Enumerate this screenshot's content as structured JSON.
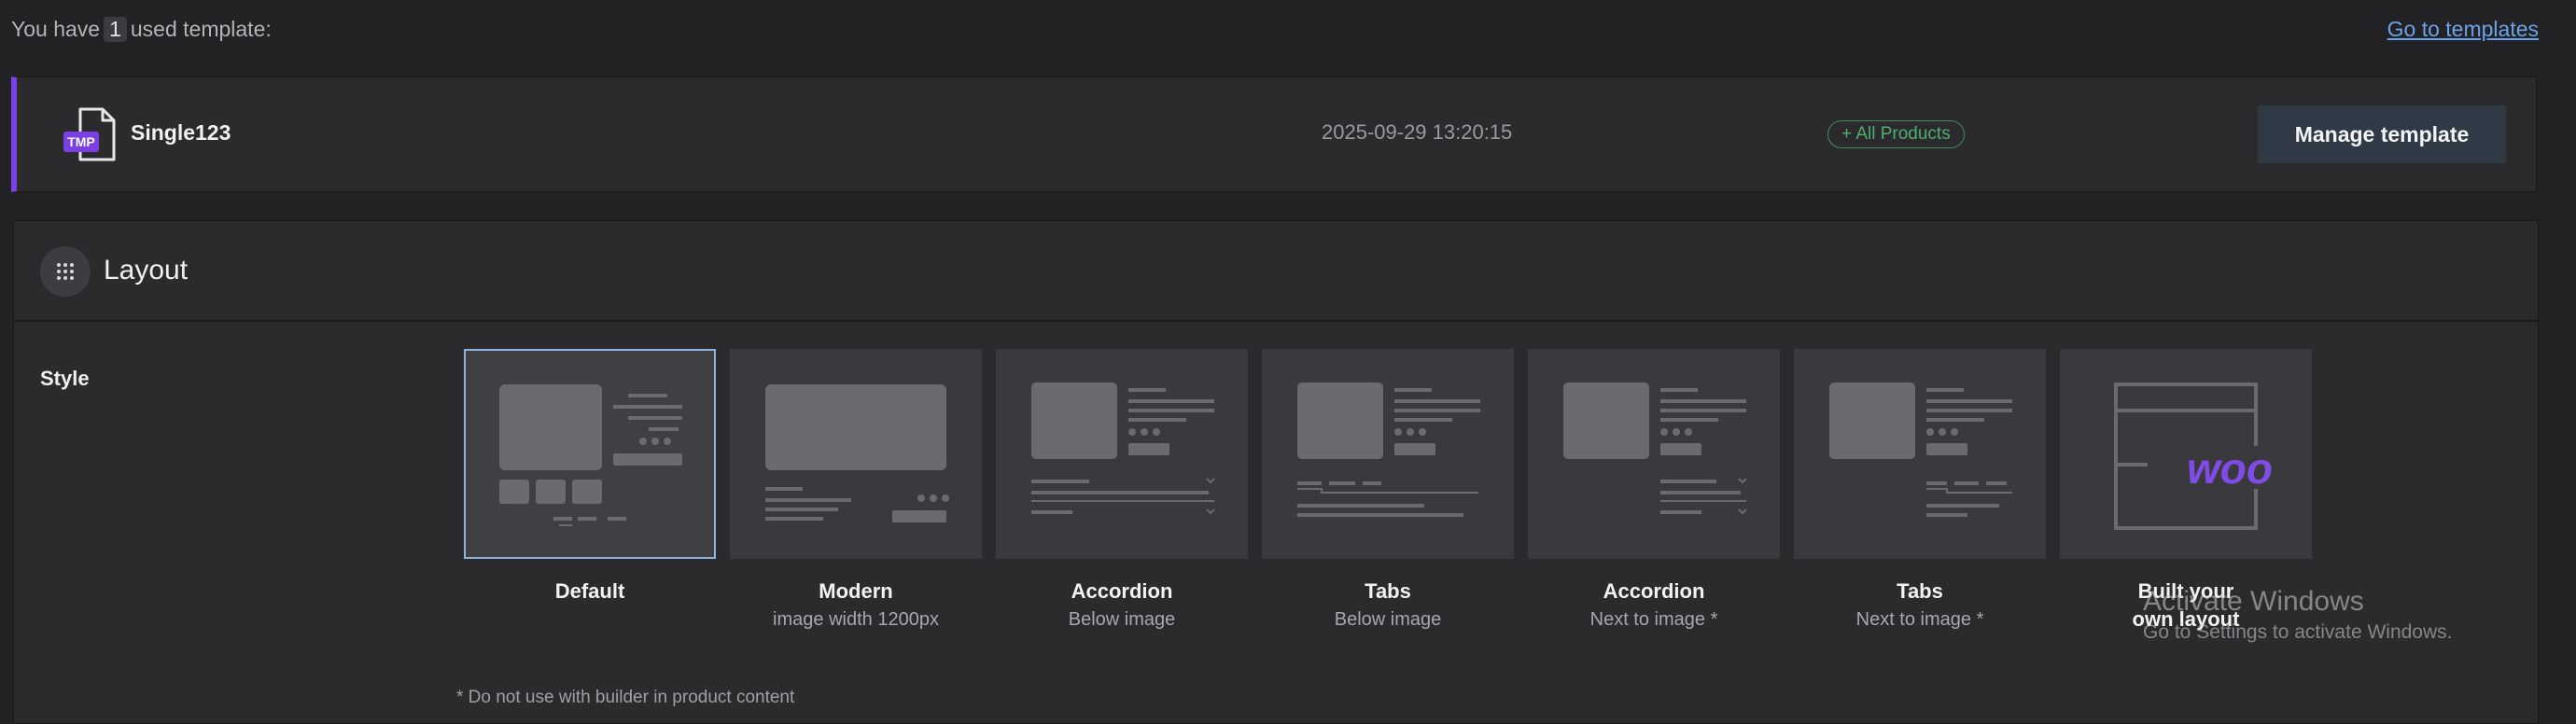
{
  "header": {
    "prefix": "You have",
    "count": "1",
    "suffix": "used template:",
    "link": "Go to templates"
  },
  "template": {
    "icon_label": "TMP",
    "name": "Single123",
    "date": "2025-09-29 13:20:15",
    "badge": "+ All Products",
    "manage_button": "Manage template"
  },
  "layout": {
    "title": "Layout",
    "style_label": "Style",
    "options": [
      {
        "title": "Default",
        "subtitle": "",
        "selected": true
      },
      {
        "title": "Modern",
        "subtitle": "image width 1200px",
        "selected": false
      },
      {
        "title": "Accordion",
        "subtitle": "Below image",
        "selected": false
      },
      {
        "title": "Tabs",
        "subtitle": "Below image",
        "selected": false
      },
      {
        "title": "Accordion",
        "subtitle": "Next to image *",
        "selected": false
      },
      {
        "title": "Tabs",
        "subtitle": "Next to image *",
        "selected": false
      },
      {
        "title": "Built your own layout",
        "subtitle": "",
        "selected": false,
        "logo": "woo"
      }
    ],
    "footnote": "* Do not use with builder in product content"
  },
  "watermark": {
    "title": "Activate Windows",
    "subtitle": "Go to Settings to activate Windows."
  },
  "colors": {
    "accent": "#7b3fe4",
    "link": "#6ba3ea",
    "badge": "#4fae70",
    "selected_border": "#8ab4de"
  }
}
